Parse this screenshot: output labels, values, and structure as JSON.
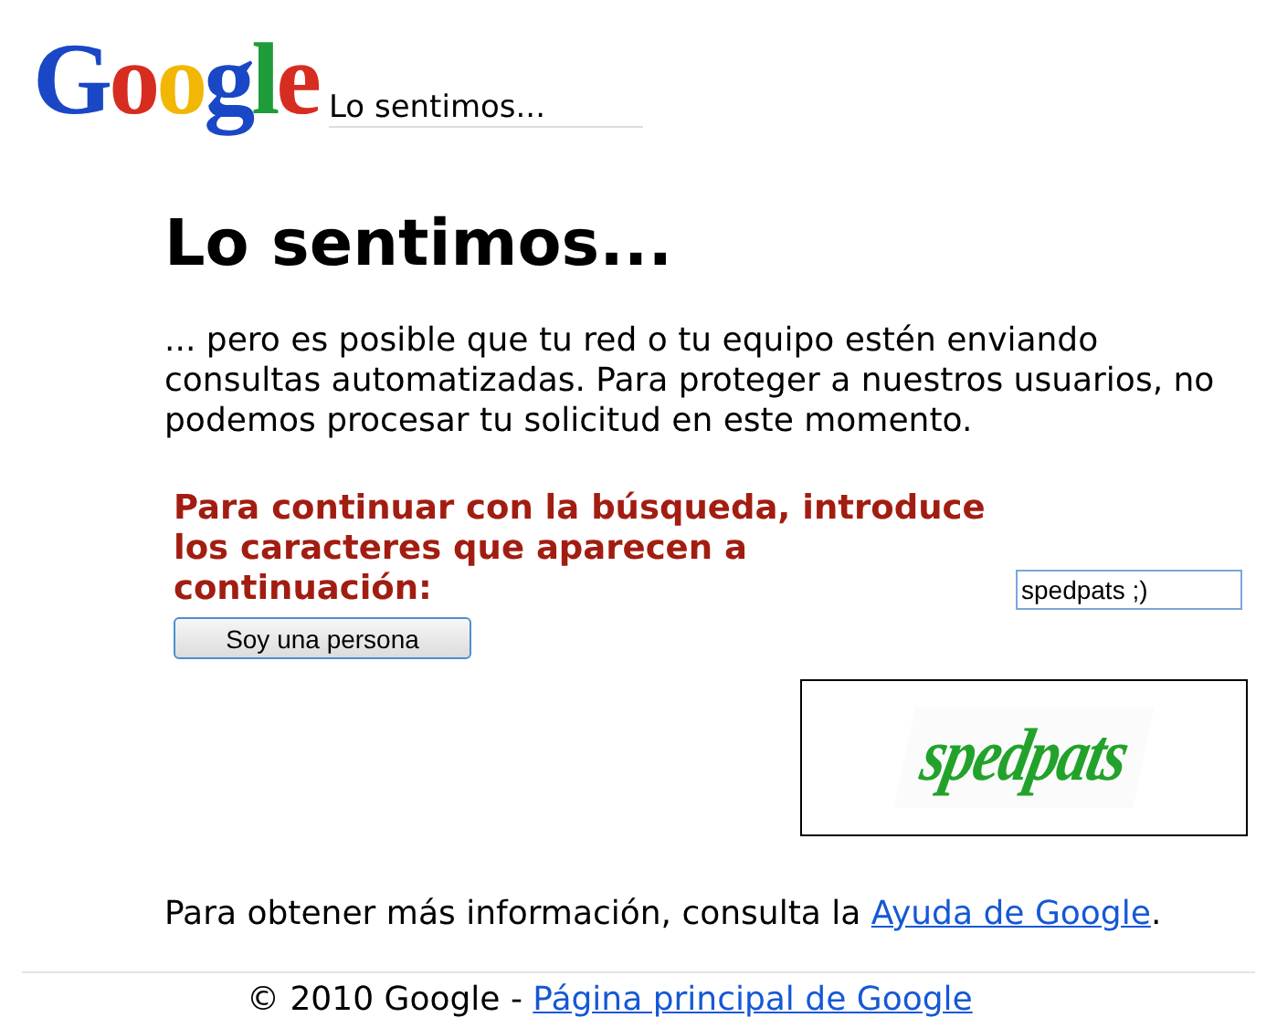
{
  "header": {
    "logo": "Google",
    "title": "Lo sentimos..."
  },
  "heading": "Lo sentimos...",
  "message": "... pero es posible que tu red o tu equipo estén enviando consultas automatizadas. Para proteger a nuestros usuarios, no podemos procesar tu solicitud en este momento.",
  "prompt": "Para continuar con la búsqueda, introduce los caracteres que aparecen a continuación:",
  "answer": {
    "value": "spedpats ;)"
  },
  "submit_button": "Soy una persona",
  "captcha": {
    "text": "spedpats"
  },
  "help": {
    "text": "Para obtener más información, consulta la ",
    "link": "Ayuda de Google",
    "after": "."
  },
  "footer": {
    "copyright": "© 2010 Google - ",
    "link": "Página principal de Google"
  }
}
